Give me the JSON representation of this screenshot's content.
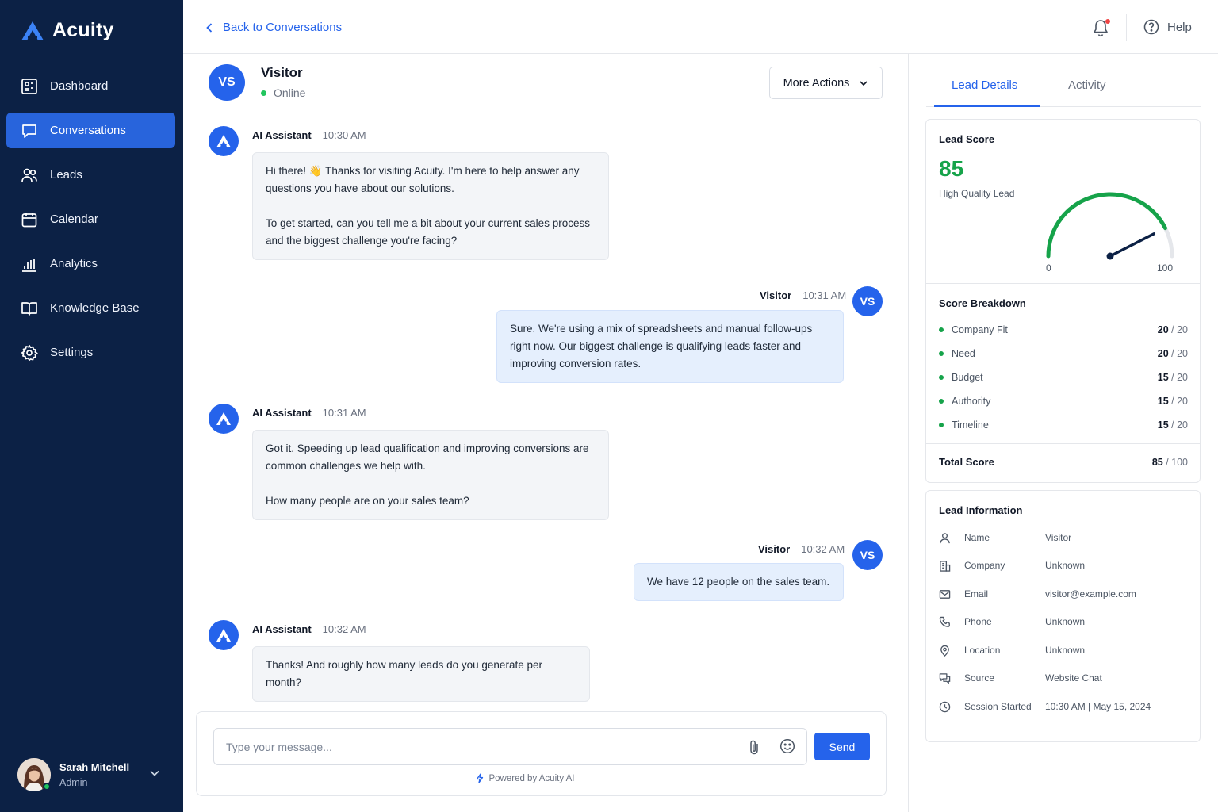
{
  "app": {
    "name": "Acuity"
  },
  "sidebar": {
    "items": [
      {
        "label": "Dashboard",
        "icon": "dashboard-icon"
      },
      {
        "label": "Conversations",
        "icon": "chat-bubble-icon",
        "active": true
      },
      {
        "label": "Leads",
        "icon": "users-icon"
      },
      {
        "label": "Calendar",
        "icon": "calendar-icon"
      },
      {
        "label": "Analytics",
        "icon": "bar-chart-icon"
      },
      {
        "label": "Knowledge Base",
        "icon": "book-icon"
      },
      {
        "label": "Settings",
        "icon": "gear-icon"
      }
    ],
    "user": {
      "name": "Sarah Mitchell",
      "role": "Admin"
    }
  },
  "topbar": {
    "back_label": "Back to Conversations",
    "help_label": "Help"
  },
  "chat": {
    "header": {
      "initials": "VS",
      "name": "Visitor",
      "status": "Online",
      "more_actions": "More Actions"
    },
    "messages": [
      {
        "sender": "AI Assistant",
        "time": "10:30 AM",
        "paragraphs": [
          "Hi there! 👋 Thanks for visiting Acuity. I'm here to help answer any questions you have about our solutions.",
          "To get started, can you tell me a bit about your current sales process and the biggest challenge you're facing?"
        ]
      },
      {
        "sender": "Visitor",
        "initials": "VS",
        "time": "10:31 AM",
        "paragraphs": [
          "Sure. We're using a mix of spreadsheets and manual follow-ups right now. Our biggest challenge is qualifying leads faster and improving conversion rates."
        ]
      },
      {
        "sender": "AI Assistant",
        "time": "10:31 AM",
        "paragraphs": [
          "Got it. Speeding up lead qualification and improving conversions are common challenges we help with.",
          "How many people are on your sales team?"
        ]
      },
      {
        "sender": "Visitor",
        "initials": "VS",
        "time": "10:32 AM",
        "paragraphs": [
          "We have 12 people on the sales team."
        ]
      },
      {
        "sender": "AI Assistant",
        "time": "10:32 AM",
        "paragraphs": [
          "Thanks! And roughly how many leads do you generate per month?"
        ]
      }
    ],
    "composer": {
      "placeholder": "Type your message...",
      "value": "",
      "send_label": "Send",
      "powered_by": "Powered by Acuity AI"
    }
  },
  "panel": {
    "tabs": [
      {
        "label": "Lead Details",
        "active": true
      },
      {
        "label": "Activity"
      }
    ],
    "lead_score": {
      "title": "Lead Score",
      "value": "85",
      "label": "High Quality Lead",
      "gauge_min": "0",
      "gauge_max": "100",
      "gauge_fraction": 0.85
    },
    "breakdown": {
      "title": "Score Breakdown",
      "items": [
        {
          "label": "Company Fit",
          "score": "20",
          "max": "20"
        },
        {
          "label": "Need",
          "score": "20",
          "max": "20"
        },
        {
          "label": "Budget",
          "score": "15",
          "max": "20"
        },
        {
          "label": "Authority",
          "score": "15",
          "max": "20"
        },
        {
          "label": "Timeline",
          "score": "15",
          "max": "20"
        }
      ],
      "total_label": "Total Score",
      "total_score": "85",
      "total_max": "100"
    },
    "lead_info": {
      "title": "Lead Information",
      "rows": [
        {
          "key": "Name",
          "value": "Visitor",
          "icon": "user-icon"
        },
        {
          "key": "Company",
          "value": "Unknown",
          "icon": "building-icon"
        },
        {
          "key": "Email",
          "value": "visitor@example.com",
          "icon": "mail-icon"
        },
        {
          "key": "Phone",
          "value": "Unknown",
          "icon": "phone-icon"
        },
        {
          "key": "Location",
          "value": "Unknown",
          "icon": "map-pin-icon"
        },
        {
          "key": "Source",
          "value": "Website Chat",
          "icon": "chat-icon"
        },
        {
          "key": "Session Started",
          "value": "10:30 AM | May 15, 2024",
          "icon": "clock-icon"
        }
      ]
    }
  },
  "colors": {
    "sidebar_bg": "#0c2145",
    "accent": "#2563eb",
    "score_green": "#16a34a",
    "online_green": "#22c55e",
    "notification_red": "#ef4444"
  }
}
